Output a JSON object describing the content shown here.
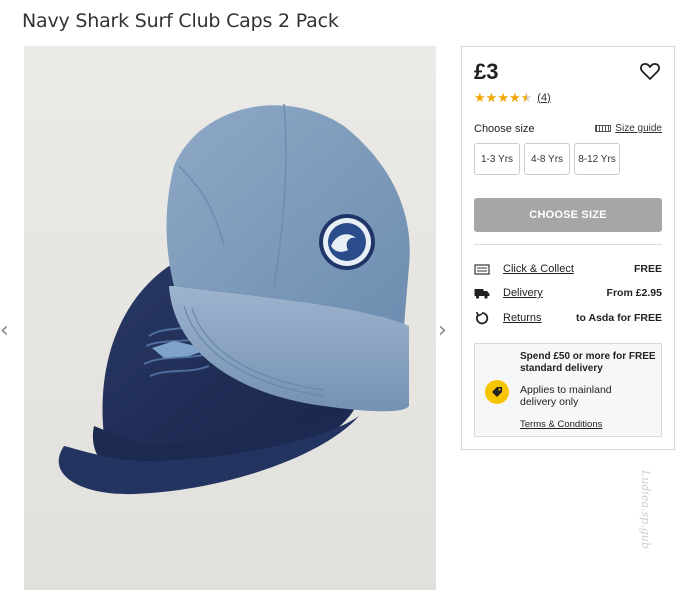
{
  "product": {
    "title": "Navy Shark Surf Club Caps 2 Pack",
    "price": "£3",
    "rating_value": 4.5,
    "rating_count": "(4)"
  },
  "sizing": {
    "label": "Choose size",
    "guide_label": "Size guide",
    "options": [
      "1-3 Yrs",
      "4-8 Yrs",
      "8-12 Yrs"
    ],
    "cta_label": "CHOOSE SIZE"
  },
  "delivery": [
    {
      "icon": "store-icon",
      "label": "Click & Collect",
      "value": "FREE"
    },
    {
      "icon": "truck-icon",
      "label": "Delivery",
      "value": "From £2.95"
    },
    {
      "icon": "returns-icon",
      "label": "Returns",
      "value": "to Asda for FREE"
    }
  ],
  "promo": {
    "headline": "Spend £50 or more for FREE standard delivery",
    "body": "Applies to mainland delivery only",
    "link": "Terms & Conditions"
  },
  "gallery": {
    "prev_glyph": "‹",
    "next_glyph": "›"
  },
  "watermark": "Ludiea.sp.gub",
  "colors": {
    "accent_yellow": "#f6c400",
    "star": "#f0a500",
    "cta_disabled": "#a6a6a6",
    "navy_cap": "#1f2d52",
    "blue_cap": "#7f9cbc"
  }
}
